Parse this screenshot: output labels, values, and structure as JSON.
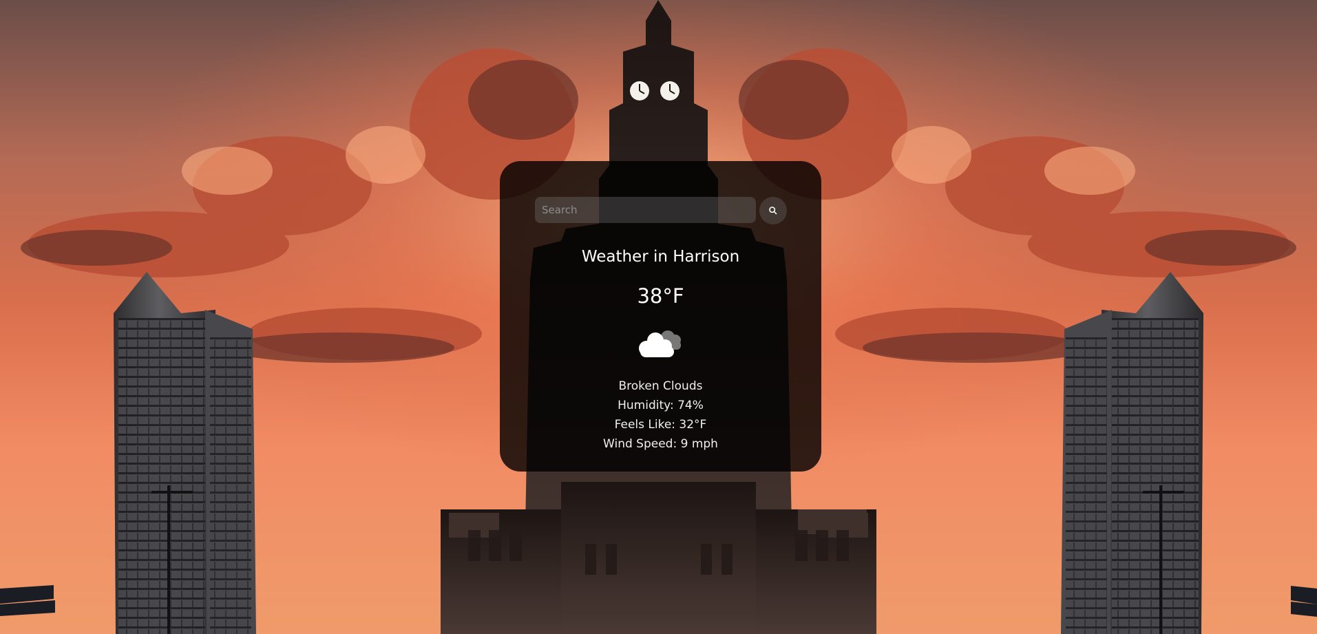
{
  "search": {
    "placeholder": "Search",
    "value": "",
    "button_icon": "search-icon"
  },
  "weather": {
    "title": "Weather in Harrison",
    "temperature": "38°F",
    "icon": "broken-clouds-icon",
    "description": "Broken Clouds",
    "humidity": "Humidity: 74%",
    "feels_like": "Feels Like: 32°F",
    "wind_speed": "Wind Speed: 9 mph"
  },
  "theme": {
    "card_background": "#000000",
    "text_color": "#ffffff",
    "sky_orange": "#f07a4e"
  }
}
